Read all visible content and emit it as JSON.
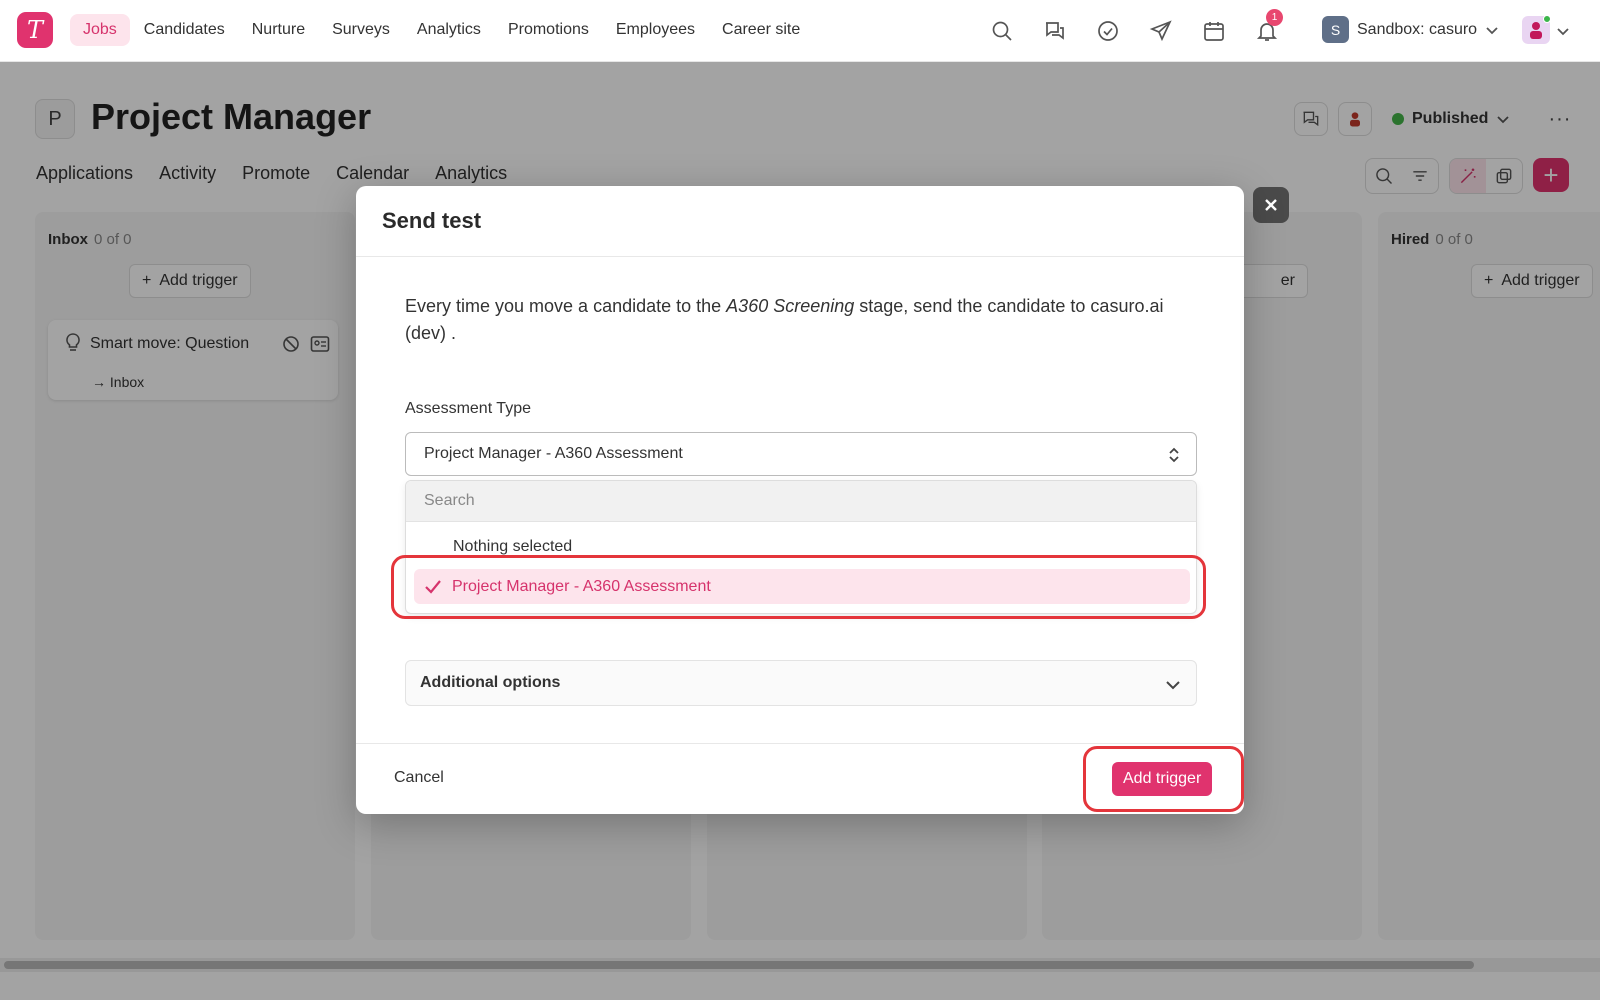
{
  "nav": {
    "logo": "T",
    "items": [
      "Jobs",
      "Candidates",
      "Nurture",
      "Surveys",
      "Analytics",
      "Promotions",
      "Employees",
      "Career site"
    ],
    "notification_count": "1",
    "sandbox_initial": "S",
    "sandbox_label": "Sandbox: casuro"
  },
  "job": {
    "badge": "P",
    "title": "Project Manager",
    "status": "Published",
    "more": "···",
    "tabs": [
      "Applications",
      "Activity",
      "Promote",
      "Calendar",
      "Analytics"
    ]
  },
  "board": {
    "inbox": {
      "name": "Inbox",
      "count": "0 of 0",
      "add_trigger": "Add trigger"
    },
    "hired": {
      "name": "Hired",
      "count": "0 of 0",
      "add_trigger": "Add trigger"
    },
    "partial_trigger": "er",
    "card": {
      "title": "Smart move: Question",
      "target": "Inbox"
    }
  },
  "modal": {
    "title": "Send test",
    "desc_before": "Every time you move a candidate to the ",
    "desc_stage": "A360 Screening",
    "desc_after": " stage, send the candidate to casuro.ai (dev) .",
    "field_label": "Assessment Type",
    "select_value": "Project Manager - A360 Assessment",
    "search_placeholder": "Search",
    "option_none": "Nothing selected",
    "option_selected": "Project Manager - A360 Assessment",
    "additional_options": "Additional options",
    "cancel": "Cancel",
    "submit": "Add trigger"
  },
  "colors": {
    "accent": "#e0336e",
    "highlight": "#e4353b",
    "published": "#44b549"
  }
}
